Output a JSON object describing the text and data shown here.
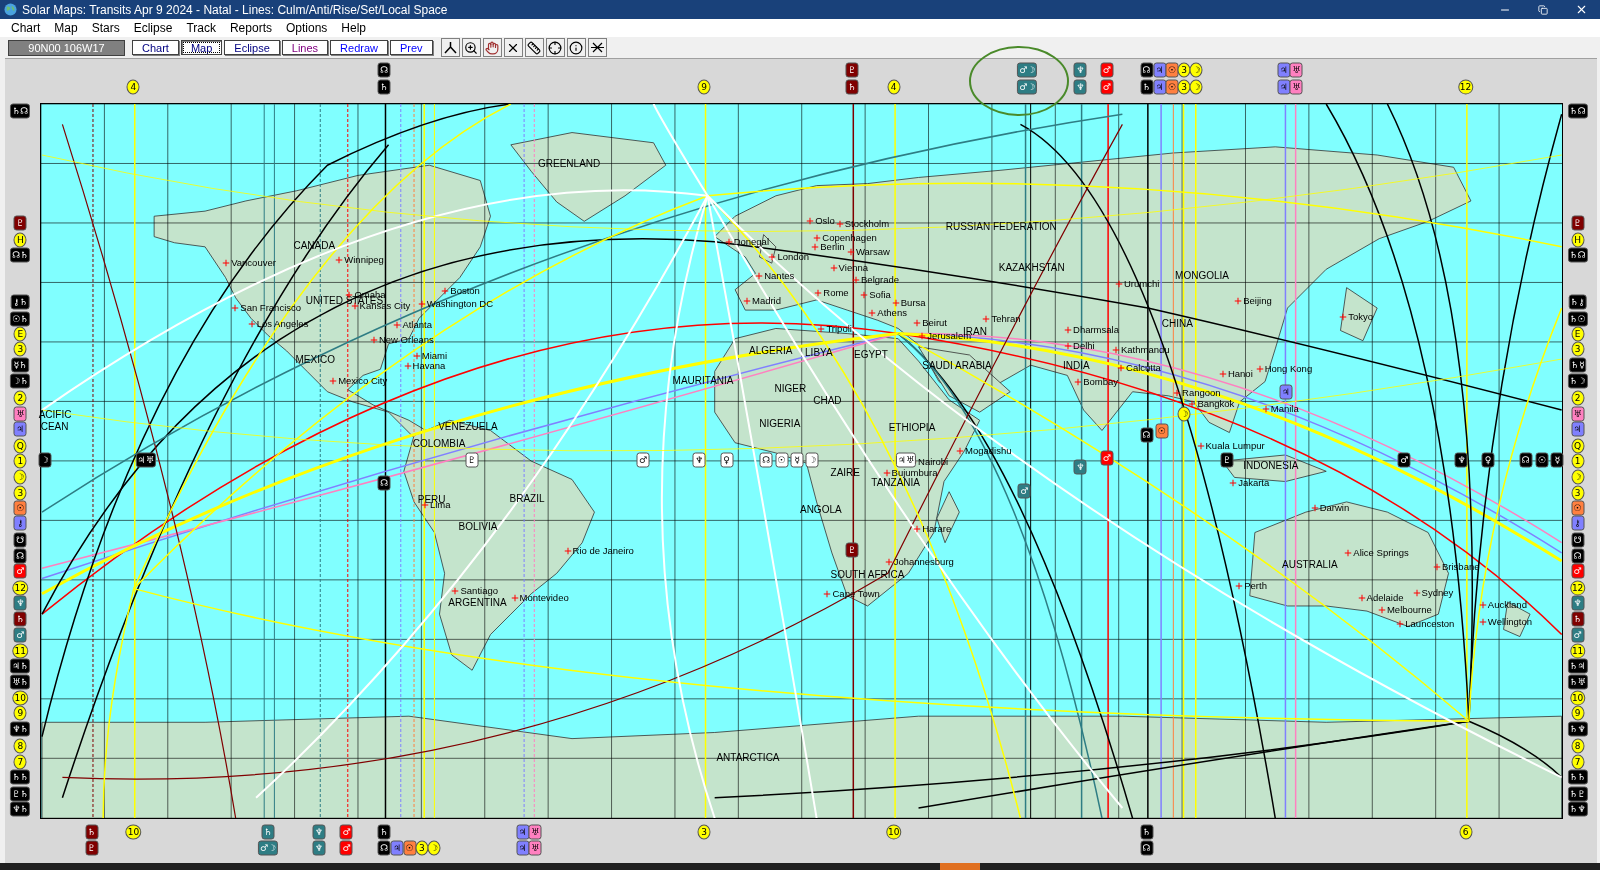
{
  "window": {
    "title": "Solar Maps: Transits Apr 9 2024 - Natal - Lines: Culm/Anti/Rise/Set/Local Space"
  },
  "menu": [
    "Chart",
    "Map",
    "Stars",
    "Eclipse",
    "Track",
    "Reports",
    "Options",
    "Help"
  ],
  "toolbar": {
    "coordinates": "90N00  106W17",
    "buttons": [
      {
        "label": "Chart",
        "selected": false,
        "color": "#000080"
      },
      {
        "label": "Map",
        "selected": true,
        "color": "#000080"
      },
      {
        "label": "Eclipse",
        "selected": false,
        "color": "#000080"
      },
      {
        "label": "Lines",
        "selected": false,
        "color": "#800080"
      },
      {
        "label": "Redraw",
        "selected": false,
        "color": "#0000ff"
      },
      {
        "label": "Prev",
        "selected": false,
        "color": "#0000ff"
      }
    ]
  },
  "map": {
    "regions": [
      "GREENLAND",
      "CANADA",
      "UNITED STATES",
      "MEXICO",
      "ACIFIC",
      "CEAN",
      "VENEZUELA",
      "COLOMBIA",
      "PERU",
      "BRAZIL",
      "BOLIVIA",
      "ARGENTINA",
      "RUSSIAN FEDERATION",
      "KAZAKHSTAN",
      "IRAN",
      "SAUDI ARABIA",
      "ALGERIA",
      "LIBYA",
      "EGYPT",
      "MAURITANIA",
      "NIGER",
      "CHAD",
      "NIGERIA",
      "ETHIOPIA",
      "ZAIRE",
      "TANZANIA",
      "ANGOLA",
      "SOUTH AFRICA",
      "ANTARCTICA",
      "INDIA",
      "MONGOLIA",
      "CHINA",
      "INDONESIA",
      "AUSTRALIA"
    ],
    "cities": [
      "Vancouver",
      "Winnipeg",
      "San Francisco",
      "Omaha",
      "Kansas City",
      "Boston",
      "Washington DC",
      "Los Angeles",
      "Atlanta",
      "New Orleans",
      "Miami",
      "Havana",
      "Mexico City",
      "Lima",
      "Rio de Janeiro",
      "Santiago",
      "Montevideo",
      "Donegal",
      "London",
      "Nantes",
      "Oslo",
      "Stockholm",
      "Copenhagen",
      "Berlin",
      "Warsaw",
      "Vienna",
      "Belgrade",
      "Rome",
      "Sofia",
      "Bursa",
      "Athens",
      "Madrid",
      "Tripoli",
      "Beirut",
      "Jerusalem",
      "Tehran",
      "Mogadishu",
      "Nairobi",
      "Bujumbura",
      "Harare",
      "Johannesburg",
      "Cape Town",
      "Dharmsala",
      "Delhi",
      "Kathmandu",
      "Calcutta",
      "Bombay",
      "Urumchi",
      "Beijing",
      "Tokyo",
      "Hanoi",
      "Hong Kong",
      "Rangoon",
      "Bangkok",
      "Manila",
      "Kuala Lumpur",
      "Jakarta",
      "Darwin",
      "Alice Springs",
      "Brisbane",
      "Perth",
      "Adelaide",
      "Sydney",
      "Melbourne",
      "Launceston",
      "Auckland",
      "Wellington"
    ],
    "top_markers": [
      {
        "glyph": "☊",
        "color": "#000000"
      },
      {
        "glyph": "♇",
        "color": "#800000"
      },
      {
        "glyph": "♂☽",
        "color": "#2e7d84"
      },
      {
        "glyph": "♆",
        "color": "#2e7d84"
      },
      {
        "glyph": "♂",
        "color": "#ff0000"
      },
      {
        "glyph": "☊",
        "color": "#000000"
      },
      {
        "glyph": "♃",
        "color": "#8080ff"
      },
      {
        "glyph": "☉",
        "color": "#ff8040"
      },
      {
        "glyph": "3",
        "color": "#ffff00"
      },
      {
        "glyph": "☽",
        "color": "#ffff00"
      },
      {
        "glyph": "♃",
        "color": "#8080ff"
      },
      {
        "glyph": "♅",
        "color": "#ff80c0"
      },
      {
        "glyph": "4",
        "color": "#ffff00"
      },
      {
        "glyph": "♄",
        "color": "#000000"
      },
      {
        "glyph": "9",
        "color": "#ffff00"
      },
      {
        "glyph": "♄",
        "color": "#800000"
      },
      {
        "glyph": "4",
        "color": "#ffff00"
      },
      {
        "glyph": "♂☽",
        "color": "#2e7d84"
      },
      {
        "glyph": "♆",
        "color": "#2e7d84"
      },
      {
        "glyph": "♂",
        "color": "#ff0000"
      },
      {
        "glyph": "♄",
        "color": "#000000"
      },
      {
        "glyph": "♃",
        "color": "#8080ff"
      },
      {
        "glyph": "☉",
        "color": "#ff8040"
      },
      {
        "glyph": "3",
        "color": "#ffff00"
      },
      {
        "glyph": "☽",
        "color": "#ffff00"
      },
      {
        "glyph": "♃",
        "color": "#8080ff"
      },
      {
        "glyph": "♅",
        "color": "#ff80c0"
      },
      {
        "glyph": "12",
        "color": "#ffff00"
      }
    ],
    "bottom_markers": [
      {
        "glyph": "♄",
        "color": "#800000"
      },
      {
        "glyph": "10",
        "color": "#ffff00"
      },
      {
        "glyph": "♄",
        "color": "#2e7d84"
      },
      {
        "glyph": "♆",
        "color": "#2e7d84"
      },
      {
        "glyph": "♂",
        "color": "#ff0000"
      },
      {
        "glyph": "♄",
        "color": "#000000"
      },
      {
        "glyph": "♃",
        "color": "#8080ff"
      },
      {
        "glyph": "♅",
        "color": "#ff80c0"
      },
      {
        "glyph": "3",
        "color": "#ffff00"
      },
      {
        "glyph": "10",
        "color": "#ffff00"
      },
      {
        "glyph": "♄",
        "color": "#000000"
      },
      {
        "glyph": "6",
        "color": "#ffff00"
      },
      {
        "glyph": "♇",
        "color": "#800000"
      },
      {
        "glyph": "♂☽",
        "color": "#2e7d84"
      },
      {
        "glyph": "♆",
        "color": "#2e7d84"
      },
      {
        "glyph": "♂",
        "color": "#ff0000"
      },
      {
        "glyph": "☊",
        "color": "#000000"
      },
      {
        "glyph": "♃",
        "color": "#8080ff"
      },
      {
        "glyph": "☉",
        "color": "#ff8040"
      },
      {
        "glyph": "3",
        "color": "#ffff00"
      },
      {
        "glyph": "☽",
        "color": "#ffff00"
      },
      {
        "glyph": "♃",
        "color": "#8080ff"
      },
      {
        "glyph": "♅",
        "color": "#ff80c0"
      },
      {
        "glyph": "☊",
        "color": "#000000"
      }
    ],
    "left_markers": [
      {
        "glyph": "♄☊",
        "color": "#000000"
      },
      {
        "glyph": "♇",
        "color": "#800000"
      },
      {
        "glyph": "H",
        "color": "#ffff00"
      },
      {
        "glyph": "☊♄",
        "color": "#000000"
      },
      {
        "glyph": "⚷♄",
        "color": "#000000"
      },
      {
        "glyph": "☉♄",
        "color": "#000000"
      },
      {
        "glyph": "E",
        "color": "#ffff00"
      },
      {
        "glyph": "3",
        "color": "#ffff00"
      },
      {
        "glyph": "☿♄",
        "color": "#000000"
      },
      {
        "glyph": "☽♄",
        "color": "#000000"
      },
      {
        "glyph": "2",
        "color": "#ffff00"
      },
      {
        "glyph": "♅",
        "color": "#ff80c0"
      },
      {
        "glyph": "♃",
        "color": "#8080ff"
      },
      {
        "glyph": "Q",
        "color": "#ffff00"
      },
      {
        "glyph": "1",
        "color": "#ffff00"
      },
      {
        "glyph": "☽",
        "color": "#ffff00"
      },
      {
        "glyph": "3",
        "color": "#ffff00"
      },
      {
        "glyph": "☉",
        "color": "#ff8040"
      },
      {
        "glyph": "⚷",
        "color": "#8080ff"
      },
      {
        "glyph": "☋",
        "color": "#000000"
      },
      {
        "glyph": "☊",
        "color": "#000000"
      },
      {
        "glyph": "♂",
        "color": "#ff0000"
      },
      {
        "glyph": "12",
        "color": "#ffff00"
      },
      {
        "glyph": "♆",
        "color": "#2e7d84"
      },
      {
        "glyph": "♄",
        "color": "#800000"
      },
      {
        "glyph": "♂",
        "color": "#2e7d84"
      },
      {
        "glyph": "11",
        "color": "#ffff00"
      },
      {
        "glyph": "♃♄",
        "color": "#000000"
      },
      {
        "glyph": "♅♄",
        "color": "#000000"
      },
      {
        "glyph": "10",
        "color": "#ffff00"
      },
      {
        "glyph": "9",
        "color": "#ffff00"
      },
      {
        "glyph": "♆♄",
        "color": "#000000"
      },
      {
        "glyph": "8",
        "color": "#ffff00"
      },
      {
        "glyph": "7",
        "color": "#ffff00"
      },
      {
        "glyph": "♄♄",
        "color": "#000000"
      },
      {
        "glyph": "♇♄",
        "color": "#000000"
      },
      {
        "glyph": "♆♄",
        "color": "#000000"
      }
    ],
    "right_markers": [
      {
        "glyph": "♄☊",
        "color": "#000000"
      },
      {
        "glyph": "♇",
        "color": "#800000"
      },
      {
        "glyph": "H",
        "color": "#ffff00"
      },
      {
        "glyph": "♄☊",
        "color": "#000000"
      },
      {
        "glyph": "♄⚷",
        "color": "#000000"
      },
      {
        "glyph": "♄☉",
        "color": "#000000"
      },
      {
        "glyph": "E",
        "color": "#ffff00"
      },
      {
        "glyph": "3",
        "color": "#ffff00"
      },
      {
        "glyph": "♄☿",
        "color": "#000000"
      },
      {
        "glyph": "♄☽",
        "color": "#000000"
      },
      {
        "glyph": "2",
        "color": "#ffff00"
      },
      {
        "glyph": "♅",
        "color": "#ff80c0"
      },
      {
        "glyph": "♃",
        "color": "#8080ff"
      },
      {
        "glyph": "Q",
        "color": "#ffff00"
      },
      {
        "glyph": "1",
        "color": "#ffff00"
      },
      {
        "glyph": "☽",
        "color": "#ffff00"
      },
      {
        "glyph": "3",
        "color": "#ffff00"
      },
      {
        "glyph": "☉",
        "color": "#ff8040"
      },
      {
        "glyph": "⚷",
        "color": "#8080ff"
      },
      {
        "glyph": "☋",
        "color": "#000000"
      },
      {
        "glyph": "☊",
        "color": "#000000"
      },
      {
        "glyph": "♂",
        "color": "#ff0000"
      },
      {
        "glyph": "12",
        "color": "#ffff00"
      },
      {
        "glyph": "♆",
        "color": "#2e7d84"
      },
      {
        "glyph": "♄",
        "color": "#800000"
      },
      {
        "glyph": "♂",
        "color": "#2e7d84"
      },
      {
        "glyph": "11",
        "color": "#ffff00"
      },
      {
        "glyph": "♄♃",
        "color": "#000000"
      },
      {
        "glyph": "♄♅",
        "color": "#000000"
      },
      {
        "glyph": "10",
        "color": "#ffff00"
      },
      {
        "glyph": "9",
        "color": "#ffff00"
      },
      {
        "glyph": "♄♆",
        "color": "#000000"
      },
      {
        "glyph": "8",
        "color": "#ffff00"
      },
      {
        "glyph": "7",
        "color": "#ffff00"
      },
      {
        "glyph": "♄♄",
        "color": "#000000"
      },
      {
        "glyph": "♄♇",
        "color": "#000000"
      },
      {
        "glyph": "♄♆",
        "color": "#000000"
      }
    ],
    "line_markers": [
      {
        "glyph": "☽",
        "color": "#000000"
      },
      {
        "glyph": "♃♅",
        "color": "#000000"
      },
      {
        "glyph": "♇",
        "color": "#ffffff"
      },
      {
        "glyph": "♂",
        "color": "#ffffff"
      },
      {
        "glyph": "♆",
        "color": "#ffffff"
      },
      {
        "glyph": "♀",
        "color": "#ffffff"
      },
      {
        "glyph": "☊",
        "color": "#ffffff"
      },
      {
        "glyph": "☉",
        "color": "#ffffff"
      },
      {
        "glyph": "☿",
        "color": "#ffffff"
      },
      {
        "glyph": "☽",
        "color": "#ffffff"
      },
      {
        "glyph": "♃♅",
        "color": "#ffffff"
      },
      {
        "glyph": "♆",
        "color": "#2e7d84"
      },
      {
        "glyph": "♂",
        "color": "#ff0000"
      },
      {
        "glyph": "♇",
        "color": "#000000"
      },
      {
        "glyph": "♂",
        "color": "#000000"
      },
      {
        "glyph": "♆",
        "color": "#000000"
      },
      {
        "glyph": "♀",
        "color": "#000000"
      },
      {
        "glyph": "☊",
        "color": "#000000"
      },
      {
        "glyph": "☉",
        "color": "#000000"
      },
      {
        "glyph": "☿",
        "color": "#000000"
      },
      {
        "glyph": "☊",
        "color": "#000000"
      },
      {
        "glyph": "♂",
        "color": "#2e7d84"
      },
      {
        "glyph": "♇",
        "color": "#800000"
      },
      {
        "glyph": "☊",
        "color": "#000000"
      },
      {
        "glyph": "☉",
        "color": "#ff8040"
      },
      {
        "glyph": "☽",
        "color": "#ffff00"
      },
      {
        "glyph": "♃",
        "color": "#8080ff"
      }
    ]
  }
}
